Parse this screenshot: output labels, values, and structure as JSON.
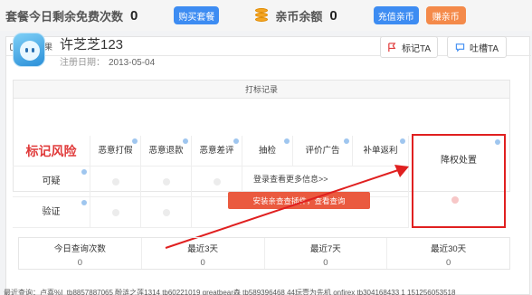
{
  "topbar": {
    "free_label": "套餐今日剩余免费次数",
    "free_count": "0",
    "buy_button": "购买套餐",
    "coin_label": "亲币余额",
    "coin_count": "0",
    "recharge_button": "充值亲币",
    "earn_button": "赚亲币"
  },
  "card": {
    "tab_label": "查询结果",
    "user": {
      "name": "许芝芝123",
      "reg_label": "注册日期：",
      "reg_date": "2013-05-04"
    },
    "actions": {
      "mark_label": "标记TA",
      "complain_label": "吐槽TA"
    },
    "records": {
      "title": "打标记录",
      "brand": "标记风险",
      "columns": [
        "恶意打假",
        "恶意退款",
        "恶意差评",
        "抽检",
        "评价广告",
        "补单返利",
        "降权处置"
      ],
      "rows": [
        "可疑",
        "验证"
      ],
      "more_link": "登录查看更多信息>>",
      "cta_button": "安装亲查查插件，查看查询"
    },
    "stats": [
      {
        "label": "今日查询次数",
        "value": "0"
      },
      {
        "label": "最近3天",
        "value": "0"
      },
      {
        "label": "最近7天",
        "value": "0"
      },
      {
        "label": "最近30天",
        "value": "0"
      }
    ],
    "recent": "最近查询：卢喜%I_tb8857887065 酚涟之莲1314 tb60221019 greatbear森 tb589396468 44玩壹为先机 onfirex tb304168433 1 151256053518"
  },
  "colors": {
    "accent_blue": "#3d8cf2",
    "accent_orange": "#f48a4a",
    "risk_red": "#e03a3a",
    "highlight_red": "#e02020"
  }
}
